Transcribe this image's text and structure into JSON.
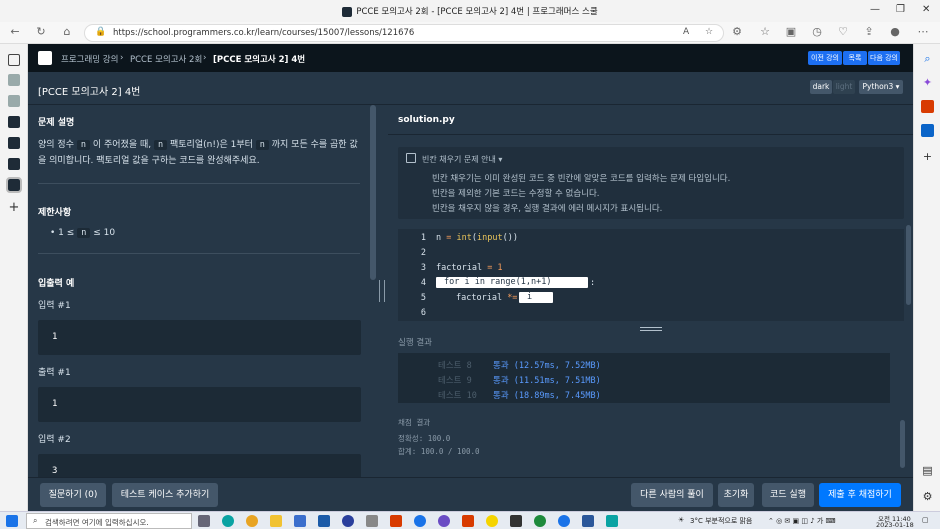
{
  "browser": {
    "window_title": "PCCE 모의고사 2회 - [PCCE 모의고사 2] 4번 | 프로그래머스 스쿨",
    "url": "https://school.programmers.co.kr/learn/courses/15007/lessons/121676"
  },
  "page": {
    "breadcrumbs": [
      "프로그래밍 강의",
      "PCCE 모의고사 2회",
      "[PCCE 모의고사 2] 4번"
    ],
    "top_buttons": [
      "이전 강의",
      "목록",
      "다음 강의"
    ],
    "title": "[PCCE 모의고사 2] 4번",
    "theme_dark": "dark",
    "theme_light": "light",
    "language": "Python3 ▾"
  },
  "problem": {
    "section_desc": "문제 설명",
    "desc_a": "양의 정수",
    "desc_b": "n",
    "desc_c": "이 주어졌을 때,",
    "desc_d": "n",
    "desc_e": "팩토리얼(n!)은 1부터",
    "desc_f": "n",
    "desc_g": "까지 모든 수를 곱한 값",
    "desc_line2": "을 의미합니다. 팩토리얼 값을 구하는 코드를 완성해주세요.",
    "section_limit": "제한사항",
    "limit_a": "1 ≤",
    "limit_b": "n",
    "limit_c": "≤ 10",
    "section_io": "입출력 예",
    "input1_label": "입력 #1",
    "input1_value": "1",
    "output1_label": "출력 #1",
    "output1_value": "1",
    "input2_label": "입력 #2",
    "input2_value": "3"
  },
  "editor": {
    "filename": "solution.py",
    "info_title": "빈칸 채우기 문제 안내 ▾",
    "info_lines": [
      "빈칸 채우기는 이미 완성된 코드 중 빈칸에 알맞은 코드를 입력하는 문제 타입입니다.",
      "빈칸을 제외한 기본 코드는 수정할 수 없습니다.",
      "빈칸을 채우지 않을 경우, 실행 결과에 에러 메시지가 표시됩니다."
    ],
    "line_numbers": [
      "1",
      "2",
      "3",
      "4",
      "5",
      "6"
    ],
    "code": {
      "l1_a": "n ",
      "l1_b": "=",
      "l1_c": "int",
      "l1_d": "(",
      "l1_e": "input",
      "l1_f": "())",
      "l3_a": "factorial ",
      "l3_b": "=",
      "l3_c": " 1",
      "l4_blank": "for i in range(1,n+1)",
      "l4_colon": ":",
      "l5_a": "factorial ",
      "l5_b": "*=",
      "l5_blank": "i"
    }
  },
  "result": {
    "label": "실행 결과",
    "tests": [
      {
        "name": "테스트 8",
        "result": "통과 (12.57ms, 7.52MB)"
      },
      {
        "name": "테스트 9",
        "result": "통과 (11.51ms, 7.51MB)"
      },
      {
        "name": "테스트 10",
        "result": "통과 (18.89ms, 7.45MB)"
      }
    ],
    "score_label": "채점 결과",
    "accuracy": "정확성: 100.0",
    "total": "합계: 100.0 / 100.0"
  },
  "bottom": {
    "ask": "질문하기 (0)",
    "add_test": "테스트 케이스 추가하기",
    "others": "다른 사람의 풀이",
    "reset": "초기화",
    "run": "코드 실행",
    "submit": "제출 후 채점하기"
  },
  "taskbar": {
    "search_placeholder": "검색하려면 여기에 입력하십시오.",
    "weather": "3°C 부분적으로 맑음",
    "time": "오전 11:40",
    "date": "2023-01-18"
  },
  "colors": {
    "page_bg": "#263747",
    "nav_bg": "#0c151c",
    "accent_blue": "#0078ff",
    "pass_text": "#5a9bff"
  }
}
